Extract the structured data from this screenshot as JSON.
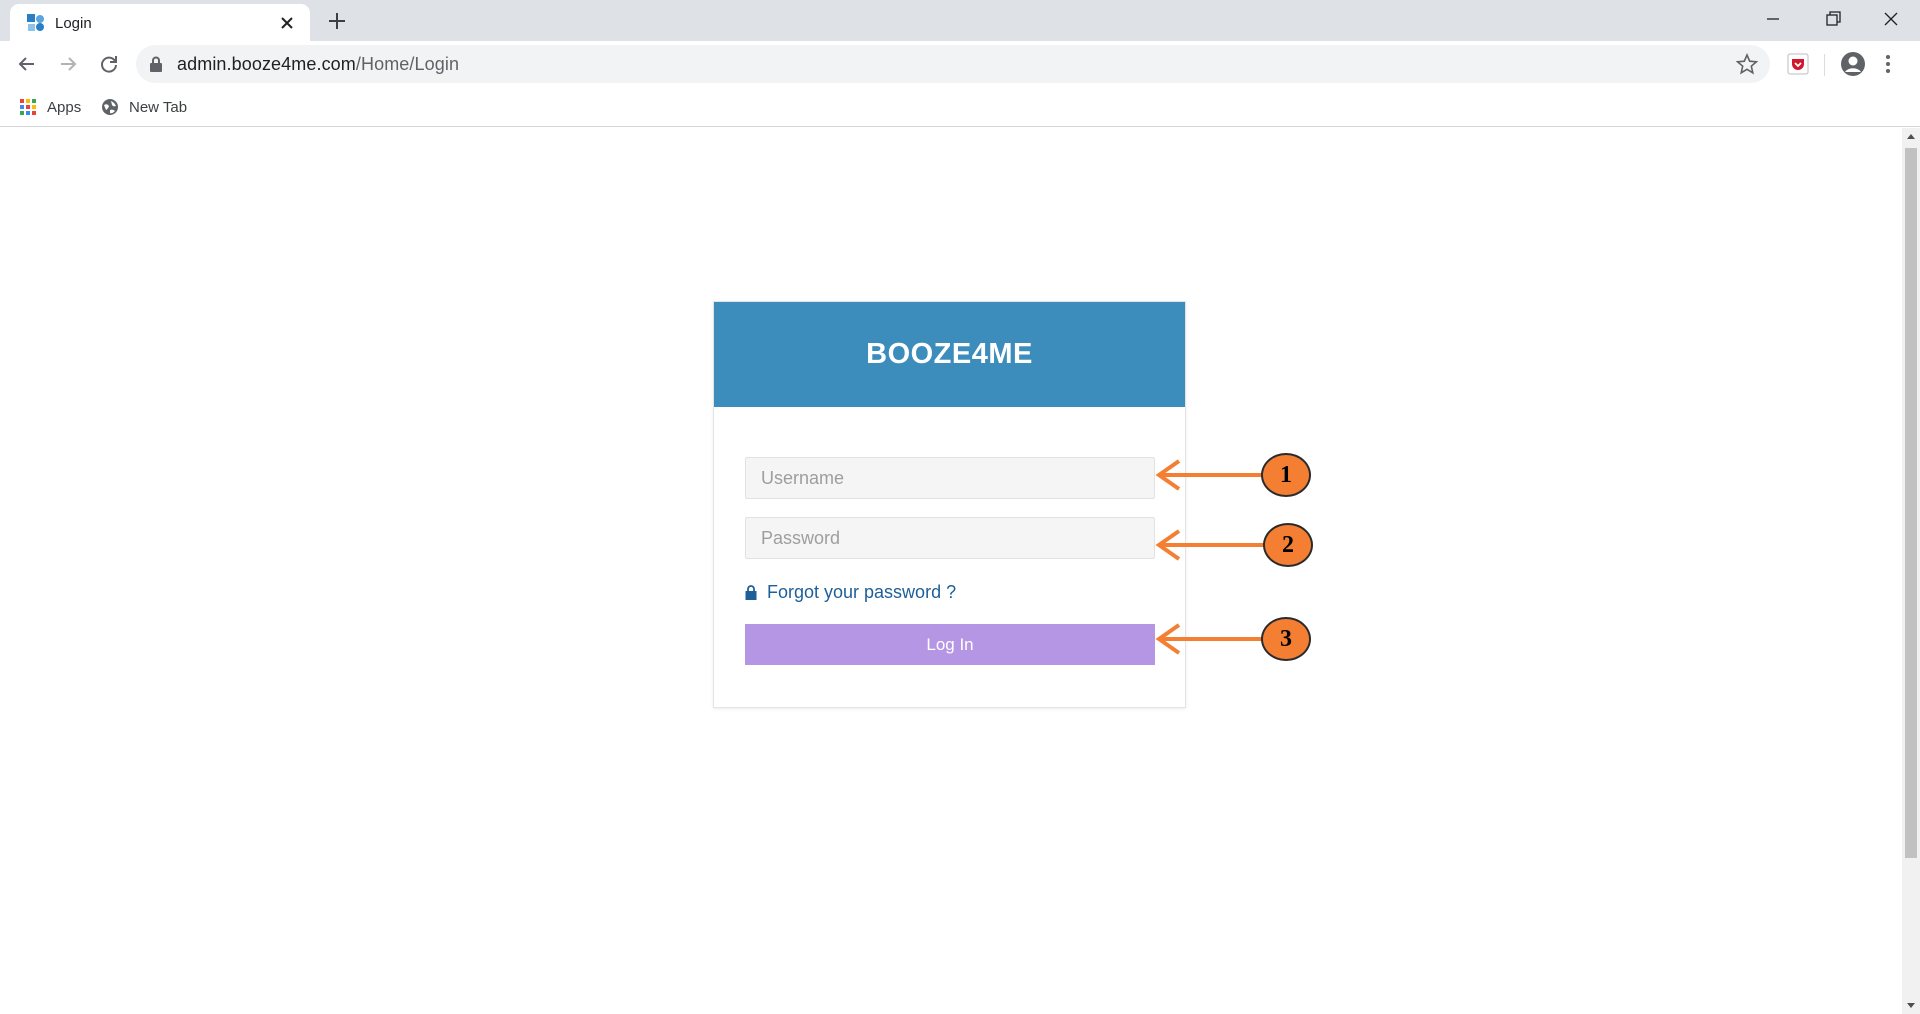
{
  "browser": {
    "tab_title": "Login",
    "url_host": "admin.booze4me.com",
    "url_path": "/Home/Login",
    "bookmarks": [
      {
        "label": "Apps",
        "icon": "apps-grid-icon"
      },
      {
        "label": "New Tab",
        "icon": "globe-icon"
      }
    ]
  },
  "login": {
    "brand": "BOOZE4ME",
    "username_placeholder": "Username",
    "password_placeholder": "Password",
    "forgot_label": "Forgot your password ?",
    "login_label": "Log In"
  },
  "annotations": [
    {
      "number": "1"
    },
    {
      "number": "2"
    },
    {
      "number": "3"
    }
  ],
  "colors": {
    "header": "#3c8dbc",
    "login_button": "#b596e4",
    "link": "#1e5f99",
    "annotation": "#f47f32"
  }
}
